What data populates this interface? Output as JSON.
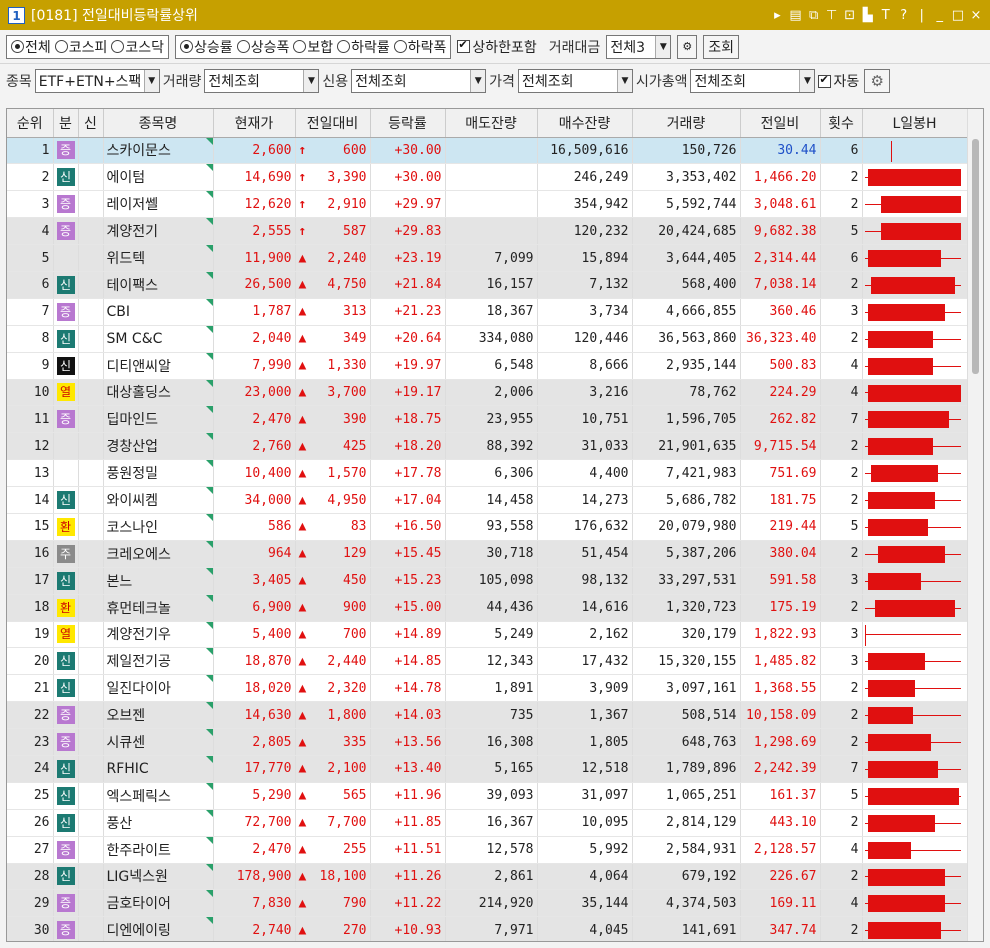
{
  "window": {
    "num": "1",
    "title": "[0181] 전일대비등락률상위",
    "icons": [
      "▸",
      "▤",
      "⧉",
      "⊤",
      "⊡",
      "▙",
      "T",
      "?",
      "|",
      "_",
      "□",
      "×"
    ]
  },
  "market": {
    "options": [
      "전체",
      "코스피",
      "코스닥"
    ],
    "selected": 0
  },
  "sort": {
    "options": [
      "상승률",
      "상승폭",
      "보합",
      "하락률",
      "하락폭"
    ],
    "selected": 0
  },
  "toolbar1": {
    "limit_check_label": "상하한포함",
    "limit_checked": true,
    "amount_label": "거래대금",
    "amount_value": "전체3",
    "query_button": "조회"
  },
  "toolbar2": {
    "item_label": "종목",
    "item_value": "ETF+ETN+스팩",
    "volume_label": "거래량",
    "volume_value": "전체조회",
    "credit_label": "신용",
    "credit_value": "전체조회",
    "price_label": "가격",
    "price_value": "전체조회",
    "cap_label": "시가총액",
    "cap_value": "전체조회",
    "auto_label": "자동",
    "auto_checked": true
  },
  "columns": [
    "순위",
    "분",
    "신",
    "종목명",
    "현재가",
    "전일대비",
    "등락률",
    "매도잔량",
    "매수잔량",
    "거래량",
    "전일비",
    "횟수",
    "L일봉H"
  ],
  "rows": [
    {
      "rank": "1",
      "badge": "증",
      "bc": "jeung",
      "name": "스카이문스",
      "price": "2,600",
      "arrow": "up",
      "diff": "600",
      "rate": "+30.00",
      "sell": "",
      "buy": "16,509,616",
      "vol": "150,726",
      "ratio": "30.44",
      "rc": "blue",
      "cnt": "6",
      "cL": 0.28,
      "cH": 0.28,
      "bL": 0.28,
      "bH": 0.28
    },
    {
      "rank": "2",
      "badge": "신",
      "bc": "sin",
      "name": "에이텀",
      "price": "14,690",
      "arrow": "up",
      "diff": "3,390",
      "rate": "+30.00",
      "sell": "",
      "buy": "246,249",
      "vol": "3,353,402",
      "ratio": "1,466.20",
      "rc": "red",
      "cnt": "2",
      "cL": 0.02,
      "cH": 0.98,
      "bL": 0.05,
      "bH": 0.98
    },
    {
      "rank": "3",
      "badge": "증",
      "bc": "jeung",
      "name": "레이저쎌",
      "price": "12,620",
      "arrow": "up",
      "diff": "2,910",
      "rate": "+29.97",
      "sell": "",
      "buy": "354,942",
      "vol": "5,592,744",
      "ratio": "3,048.61",
      "rc": "red",
      "cnt": "2",
      "cL": 0.02,
      "cH": 0.98,
      "bL": 0.18,
      "bH": 0.98
    },
    {
      "rank": "4",
      "badge": "증",
      "bc": "jeung",
      "name": "계양전기",
      "price": "2,555",
      "arrow": "up",
      "diff": "587",
      "rate": "+29.83",
      "sell": "",
      "buy": "120,232",
      "vol": "20,424,685",
      "ratio": "9,682.38",
      "rc": "red",
      "cnt": "5",
      "cL": 0.02,
      "cH": 0.98,
      "bL": 0.18,
      "bH": 0.98
    },
    {
      "rank": "5",
      "badge": "",
      "bc": "",
      "name": "위드텍",
      "price": "11,900",
      "arrow": "tri",
      "diff": "2,240",
      "rate": "+23.19",
      "sell": "7,099",
      "buy": "15,894",
      "vol": "3,644,405",
      "ratio": "2,314.44",
      "rc": "red",
      "cnt": "6",
      "cL": 0.02,
      "cH": 0.98,
      "bL": 0.05,
      "bH": 0.78
    },
    {
      "rank": "6",
      "badge": "신",
      "bc": "sin",
      "name": "테이팩스",
      "price": "26,500",
      "arrow": "tri",
      "diff": "4,750",
      "rate": "+21.84",
      "sell": "16,157",
      "buy": "7,132",
      "vol": "568,400",
      "ratio": "7,038.14",
      "rc": "red",
      "cnt": "2",
      "cL": 0.02,
      "cH": 0.98,
      "bL": 0.08,
      "bH": 0.92
    },
    {
      "rank": "7",
      "badge": "증",
      "bc": "jeung",
      "name": "CBI",
      "price": "1,787",
      "arrow": "tri",
      "diff": "313",
      "rate": "+21.23",
      "sell": "18,367",
      "buy": "3,734",
      "vol": "4,666,855",
      "ratio": "360.46",
      "rc": "red",
      "cnt": "3",
      "cL": 0.02,
      "cH": 0.98,
      "bL": 0.05,
      "bH": 0.82
    },
    {
      "rank": "8",
      "badge": "신",
      "bc": "sin",
      "name": "SM C&C",
      "price": "2,040",
      "arrow": "tri",
      "diff": "349",
      "rate": "+20.64",
      "sell": "334,080",
      "buy": "120,446",
      "vol": "36,563,860",
      "ratio": "36,323.40",
      "rc": "red",
      "cnt": "2",
      "cL": 0.02,
      "cH": 0.98,
      "bL": 0.05,
      "bH": 0.7
    },
    {
      "rank": "9",
      "badge": "신",
      "bc": "black",
      "name": "디티앤씨알",
      "price": "7,990",
      "arrow": "tri",
      "diff": "1,330",
      "rate": "+19.97",
      "sell": "6,548",
      "buy": "8,666",
      "vol": "2,935,144",
      "ratio": "500.83",
      "rc": "red",
      "cnt": "4",
      "cL": 0.02,
      "cH": 0.98,
      "bL": 0.05,
      "bH": 0.7
    },
    {
      "rank": "10",
      "badge": "열",
      "bc": "yeol",
      "name": "대상홀딩스",
      "price": "23,000",
      "arrow": "tri",
      "diff": "3,700",
      "rate": "+19.17",
      "sell": "2,006",
      "buy": "3,216",
      "vol": "78,762",
      "ratio": "224.29",
      "rc": "red",
      "cnt": "4",
      "cL": 0.02,
      "cH": 0.98,
      "bL": 0.05,
      "bH": 0.98
    },
    {
      "rank": "11",
      "badge": "증",
      "bc": "jeung",
      "name": "딥마인드",
      "price": "2,470",
      "arrow": "tri",
      "diff": "390",
      "rate": "+18.75",
      "sell": "23,955",
      "buy": "10,751",
      "vol": "1,596,705",
      "ratio": "262.82",
      "rc": "red",
      "cnt": "7",
      "cL": 0.02,
      "cH": 0.98,
      "bL": 0.05,
      "bH": 0.86
    },
    {
      "rank": "12",
      "badge": "",
      "bc": "",
      "name": "경창산업",
      "price": "2,760",
      "arrow": "tri",
      "diff": "425",
      "rate": "+18.20",
      "sell": "88,392",
      "buy": "31,033",
      "vol": "21,901,635",
      "ratio": "9,715.54",
      "rc": "red",
      "cnt": "2",
      "cL": 0.02,
      "cH": 0.98,
      "bL": 0.05,
      "bH": 0.7
    },
    {
      "rank": "13",
      "badge": "",
      "bc": "",
      "name": "풍원정밀",
      "price": "10,400",
      "arrow": "tri",
      "diff": "1,570",
      "rate": "+17.78",
      "sell": "6,306",
      "buy": "4,400",
      "vol": "7,421,983",
      "ratio": "751.69",
      "rc": "red",
      "cnt": "2",
      "cL": 0.02,
      "cH": 0.98,
      "bL": 0.08,
      "bH": 0.75
    },
    {
      "rank": "14",
      "badge": "신",
      "bc": "sin",
      "name": "와이씨켐",
      "price": "34,000",
      "arrow": "tri",
      "diff": "4,950",
      "rate": "+17.04",
      "sell": "14,458",
      "buy": "14,273",
      "vol": "5,686,782",
      "ratio": "181.75",
      "rc": "red",
      "cnt": "2",
      "cL": 0.02,
      "cH": 0.98,
      "bL": 0.05,
      "bH": 0.72
    },
    {
      "rank": "15",
      "badge": "환",
      "bc": "hwan",
      "name": "코스나인",
      "price": "586",
      "arrow": "tri",
      "diff": "83",
      "rate": "+16.50",
      "sell": "93,558",
      "buy": "176,632",
      "vol": "20,079,980",
      "ratio": "219.44",
      "rc": "red",
      "cnt": "5",
      "cL": 0.02,
      "cH": 0.98,
      "bL": 0.05,
      "bH": 0.65
    },
    {
      "rank": "16",
      "badge": "주",
      "bc": "ju",
      "name": "크레오에스",
      "price": "964",
      "arrow": "tri",
      "diff": "129",
      "rate": "+15.45",
      "sell": "30,718",
      "buy": "51,454",
      "vol": "5,387,206",
      "ratio": "380.04",
      "rc": "red",
      "cnt": "2",
      "cL": 0.02,
      "cH": 0.98,
      "bL": 0.15,
      "bH": 0.82
    },
    {
      "rank": "17",
      "badge": "신",
      "bc": "sin",
      "name": "본느",
      "price": "3,405",
      "arrow": "tri",
      "diff": "450",
      "rate": "+15.23",
      "sell": "105,098",
      "buy": "98,132",
      "vol": "33,297,531",
      "ratio": "591.58",
      "rc": "red",
      "cnt": "3",
      "cL": 0.02,
      "cH": 0.98,
      "bL": 0.05,
      "bH": 0.58
    },
    {
      "rank": "18",
      "badge": "환",
      "bc": "hwan",
      "name": "휴먼테크놀",
      "price": "6,900",
      "arrow": "tri",
      "diff": "900",
      "rate": "+15.00",
      "sell": "44,436",
      "buy": "14,616",
      "vol": "1,320,723",
      "ratio": "175.19",
      "rc": "red",
      "cnt": "2",
      "cL": 0.02,
      "cH": 0.98,
      "bL": 0.12,
      "bH": 0.92
    },
    {
      "rank": "19",
      "badge": "열",
      "bc": "yeol",
      "name": "계양전기우",
      "price": "5,400",
      "arrow": "tri",
      "diff": "700",
      "rate": "+14.89",
      "sell": "5,249",
      "buy": "2,162",
      "vol": "320,179",
      "ratio": "1,822.93",
      "rc": "red",
      "cnt": "3",
      "cL": 0.02,
      "cH": 0.98,
      "bL": 0.02,
      "bH": 0.03
    },
    {
      "rank": "20",
      "badge": "신",
      "bc": "sin",
      "name": "제일전기공",
      "price": "18,870",
      "arrow": "tri",
      "diff": "2,440",
      "rate": "+14.85",
      "sell": "12,343",
      "buy": "17,432",
      "vol": "15,320,155",
      "ratio": "1,485.82",
      "rc": "red",
      "cnt": "3",
      "cL": 0.02,
      "cH": 0.98,
      "bL": 0.05,
      "bH": 0.62
    },
    {
      "rank": "21",
      "badge": "신",
      "bc": "sin",
      "name": "일진다이아",
      "price": "18,020",
      "arrow": "tri",
      "diff": "2,320",
      "rate": "+14.78",
      "sell": "1,891",
      "buy": "3,909",
      "vol": "3,097,161",
      "ratio": "1,368.55",
      "rc": "red",
      "cnt": "2",
      "cL": 0.02,
      "cH": 0.98,
      "bL": 0.05,
      "bH": 0.52
    },
    {
      "rank": "22",
      "badge": "증",
      "bc": "jeung",
      "name": "오브젠",
      "price": "14,630",
      "arrow": "tri",
      "diff": "1,800",
      "rate": "+14.03",
      "sell": "735",
      "buy": "1,367",
      "vol": "508,514",
      "ratio": "10,158.09",
      "rc": "red",
      "cnt": "2",
      "cL": 0.02,
      "cH": 0.98,
      "bL": 0.05,
      "bH": 0.5
    },
    {
      "rank": "23",
      "badge": "증",
      "bc": "jeung",
      "name": "시큐센",
      "price": "2,805",
      "arrow": "tri",
      "diff": "335",
      "rate": "+13.56",
      "sell": "16,308",
      "buy": "1,805",
      "vol": "648,763",
      "ratio": "1,298.69",
      "rc": "red",
      "cnt": "2",
      "cL": 0.02,
      "cH": 0.98,
      "bL": 0.05,
      "bH": 0.68
    },
    {
      "rank": "24",
      "badge": "신",
      "bc": "sin",
      "name": "RFHIC",
      "price": "17,770",
      "arrow": "tri",
      "diff": "2,100",
      "rate": "+13.40",
      "sell": "5,165",
      "buy": "12,518",
      "vol": "1,789,896",
      "ratio": "2,242.39",
      "rc": "red",
      "cnt": "7",
      "cL": 0.02,
      "cH": 0.98,
      "bL": 0.05,
      "bH": 0.75
    },
    {
      "rank": "25",
      "badge": "신",
      "bc": "sin",
      "name": "엑스페릭스",
      "price": "5,290",
      "arrow": "tri",
      "diff": "565",
      "rate": "+11.96",
      "sell": "39,093",
      "buy": "31,097",
      "vol": "1,065,251",
      "ratio": "161.37",
      "rc": "red",
      "cnt": "5",
      "cL": 0.02,
      "cH": 0.98,
      "bL": 0.05,
      "bH": 0.96
    },
    {
      "rank": "26",
      "badge": "신",
      "bc": "sin",
      "name": "풍산",
      "price": "72,700",
      "arrow": "tri",
      "diff": "7,700",
      "rate": "+11.85",
      "sell": "16,367",
      "buy": "10,095",
      "vol": "2,814,129",
      "ratio": "443.10",
      "rc": "red",
      "cnt": "2",
      "cL": 0.02,
      "cH": 0.98,
      "bL": 0.05,
      "bH": 0.72
    },
    {
      "rank": "27",
      "badge": "증",
      "bc": "jeung",
      "name": "한주라이트",
      "price": "2,470",
      "arrow": "tri",
      "diff": "255",
      "rate": "+11.51",
      "sell": "12,578",
      "buy": "5,992",
      "vol": "2,584,931",
      "ratio": "2,128.57",
      "rc": "red",
      "cnt": "4",
      "cL": 0.02,
      "cH": 0.98,
      "bL": 0.05,
      "bH": 0.48
    },
    {
      "rank": "28",
      "badge": "신",
      "bc": "sin",
      "name": "LIG넥스원",
      "price": "178,900",
      "arrow": "tri",
      "diff": "18,100",
      "rate": "+11.26",
      "sell": "2,861",
      "buy": "4,064",
      "vol": "679,192",
      "ratio": "226.67",
      "rc": "red",
      "cnt": "2",
      "cL": 0.02,
      "cH": 0.98,
      "bL": 0.05,
      "bH": 0.82
    },
    {
      "rank": "29",
      "badge": "증",
      "bc": "jeung",
      "name": "금호타이어",
      "price": "7,830",
      "arrow": "tri",
      "diff": "790",
      "rate": "+11.22",
      "sell": "214,920",
      "buy": "35,144",
      "vol": "4,374,503",
      "ratio": "169.11",
      "rc": "red",
      "cnt": "4",
      "cL": 0.02,
      "cH": 0.98,
      "bL": 0.05,
      "bH": 0.82
    },
    {
      "rank": "30",
      "badge": "증",
      "bc": "jeung",
      "name": "디엔에이링",
      "price": "2,740",
      "arrow": "tri",
      "diff": "270",
      "rate": "+10.93",
      "sell": "7,971",
      "buy": "4,045",
      "vol": "141,691",
      "ratio": "347.74",
      "rc": "red",
      "cnt": "2",
      "cL": 0.02,
      "cH": 0.98,
      "bL": 0.05,
      "bH": 0.78
    }
  ]
}
